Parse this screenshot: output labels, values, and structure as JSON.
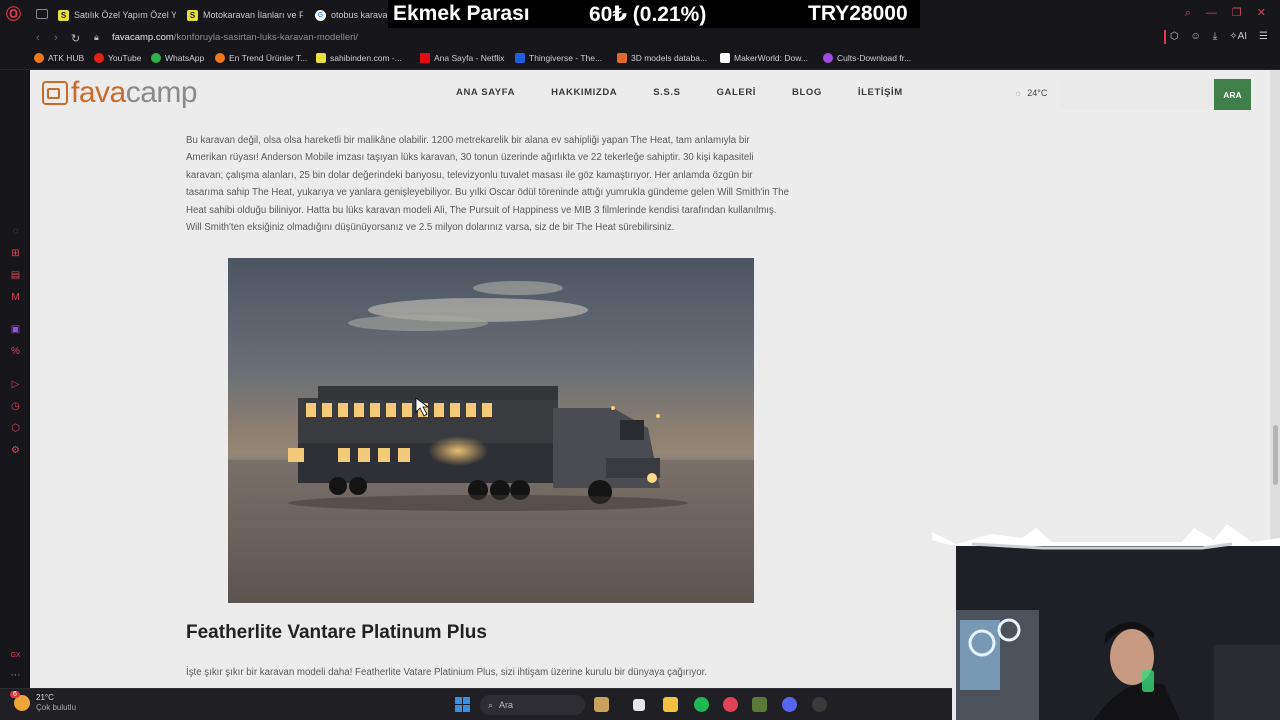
{
  "tabs": [
    {
      "label": "Satılık Özel Yapım Özel Yap",
      "favicon": "S"
    },
    {
      "label": "Motokaravan İlanları ve Fiy",
      "favicon": "S"
    },
    {
      "label": "otobus karavan",
      "favicon": "G"
    }
  ],
  "ticker": {
    "label": "Ekmek Parası",
    "amount": "60₺ (0.21%)",
    "total": "TRY28000"
  },
  "address": {
    "domain": "favacamp.com",
    "path": "/konforuyla-sasirtan-luks-karavan-modelleri/"
  },
  "toolbar": {
    "ai_label": "AI"
  },
  "bookmarks": [
    {
      "label": "ATK HUB",
      "color": "#f07a1a"
    },
    {
      "label": "YouTube",
      "color": "#e62117"
    },
    {
      "label": "WhatsApp",
      "color": "#2fb34a"
    },
    {
      "label": "En Trend Ürünler T...",
      "color": "#f07a1a"
    },
    {
      "label": "sahibinden.com -...",
      "color": "#e8e03a"
    },
    {
      "label": "Ana Sayfa - Netflix",
      "color": "#e50914"
    },
    {
      "label": "Thingiverse - The...",
      "color": "#2060e0"
    },
    {
      "label": "3D models databa...",
      "color": "#e06a2a"
    },
    {
      "label": "MakerWorld: Dow...",
      "color": "#ffffff"
    },
    {
      "label": "Cults-Download fr...",
      "color": "#a04ce0"
    }
  ],
  "site": {
    "logo_fava": "fava",
    "logo_camp": "camp",
    "menu": [
      "ANA SAYFA",
      "HAKKIMIZDA",
      "S.S.S",
      "GALERİ",
      "BLOG",
      "İLETİŞİM"
    ],
    "weather": "24°C",
    "search_button": "ARA"
  },
  "article": {
    "paragraph": "Bu karavan değil, olsa olsa hareketli bir malikâne olabilir. 1200 metrekarelik bir alana ev sahipliği yapan The Heat, tam anlamıyla bir Amerikan rüyası! Anderson Mobile imzası taşıyan lüks karavan, 30 tonun üzerinde ağırlıkta ve 22 tekerleğe sahiptir. 30 kişi kapasiteli karavan; çalışma alanları, 25 bin dolar değerindeki banyosu, televizyonlu tuvalet masası ile göz kamaştırıyor. Her anlamda özgün bir tasarıma sahip The Heat, yukarıya ve yanlara genişleyebiliyor. Bu yılki Oscar ödül töreninde attığı yumrukla gündeme gelen Will Smith'in The Heat sahibi olduğu biliniyor. Hatta bu lüks karavan modeli Ali, The Pursuit of Happiness ve MIB 3 filmlerinde kendisi tarafından kullanılmış. Will Smith'ten eksiğiniz olmadığını düşünüyorsanız ve 2.5 milyon dolarınız varsa, siz de bir The Heat sürebilirsiniz.",
    "heading": "Featherlite Vantare Platinum Plus",
    "paragraph2": "İşte şıkır şıkır bir karavan modeli daha! Featherlite Vatare Platinium Plus, sizi ihtişam üzerine kurulu bir dünyaya çağırıyor."
  },
  "taskbar": {
    "weather_temp": "21°C",
    "weather_desc": "Çok bulutlu",
    "weather_badge": "6",
    "search_placeholder": "Ara"
  }
}
